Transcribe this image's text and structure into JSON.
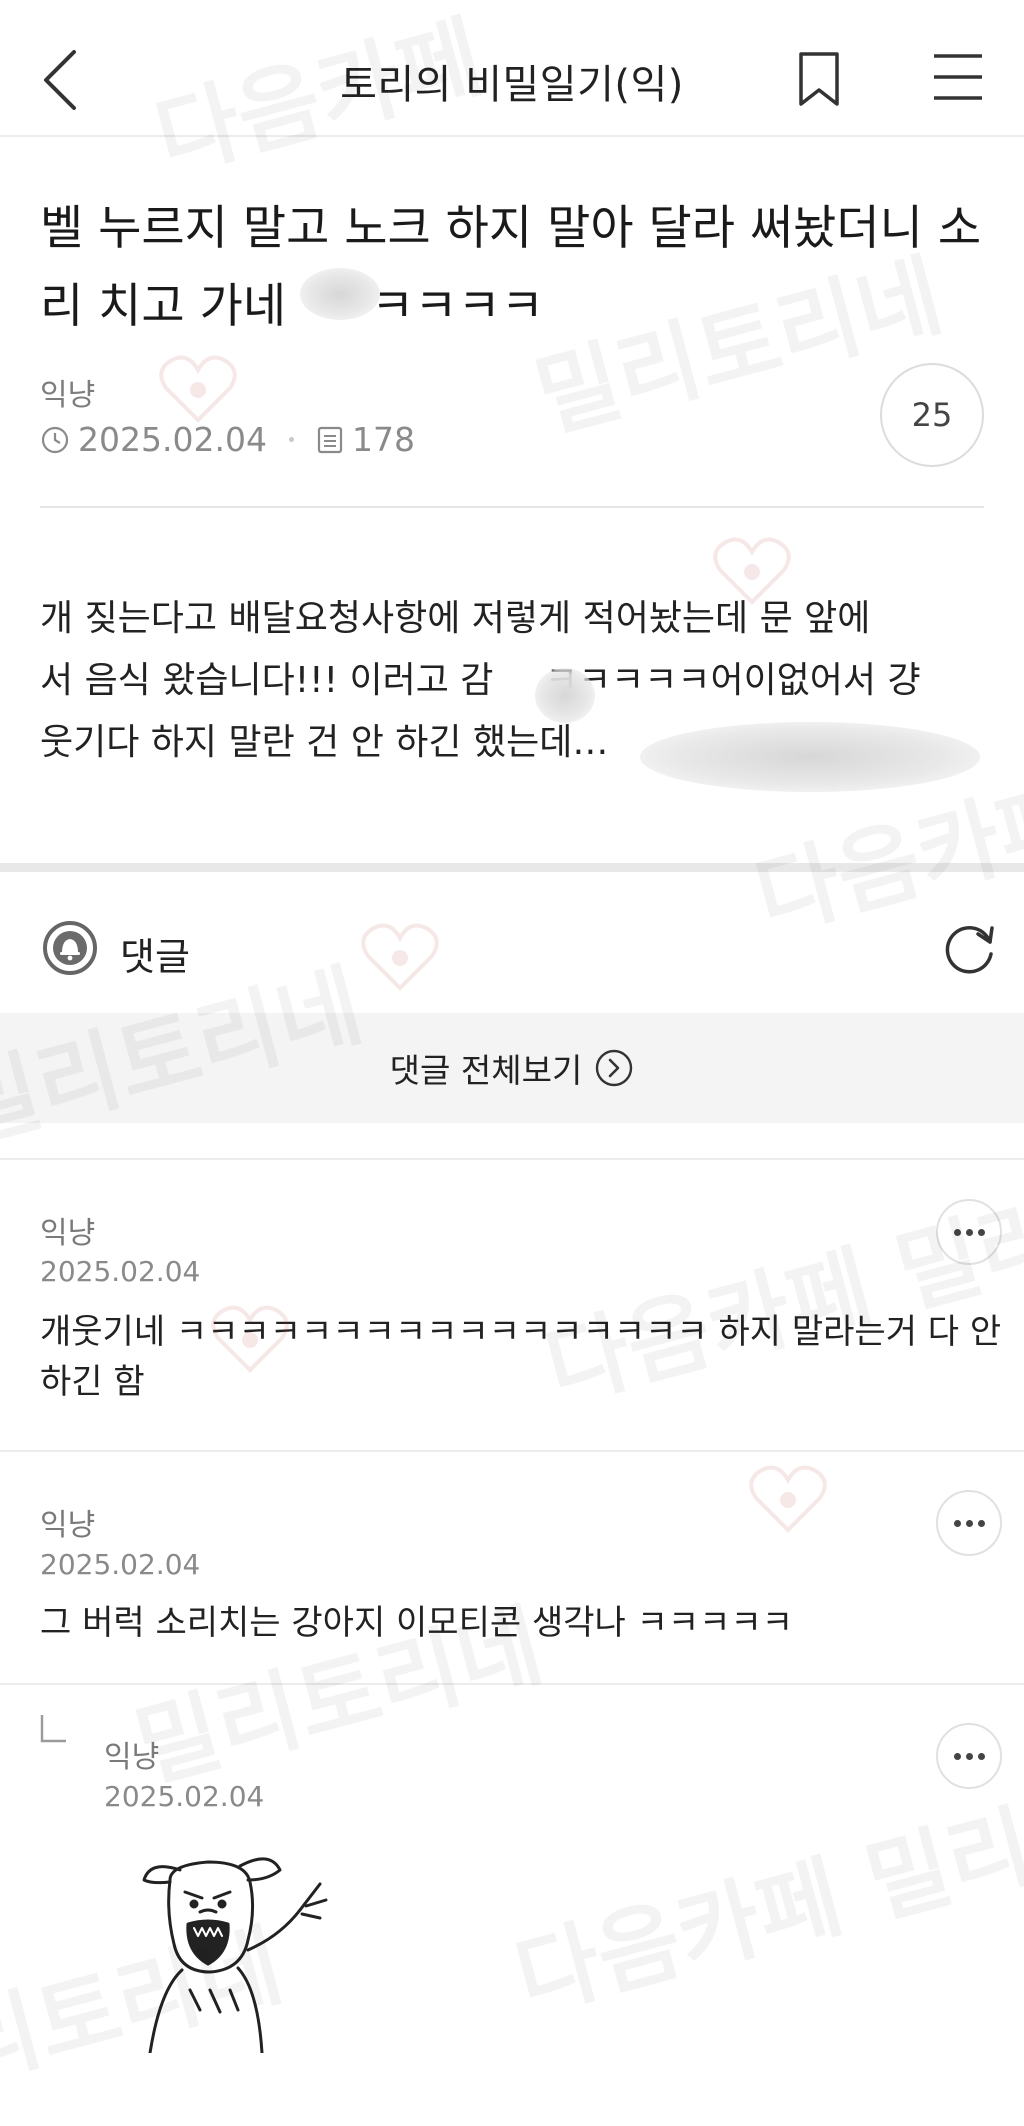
{
  "header": {
    "cafe_name": "토리의 비밀일기(익)"
  },
  "post": {
    "title_line1": "벨 누르지 말고 노크 하지 말아 달라 써놨더니 소",
    "title_line2_a": "리 치고 가네 ",
    "title_line2_b": "ㅋㅋㅋㅋ",
    "author": "익냥",
    "date": "2025.02.04",
    "views": "178",
    "comment_count": "25",
    "body_line1": "개 짖는다고 배달요청사항에 저렇게 적어놨는데 문 앞에",
    "body_line2_a": "서 음식 왔습니다!!! 이러고 감 ",
    "body_line2_b": "ㅋㅋㅋㅋㅋ어이없어서 걍",
    "body_line3": "웃기다 하지 말란 건 안 하긴 했는데…"
  },
  "comments_section": {
    "label": "댓글",
    "view_all": "댓글 전체보기"
  },
  "comments": [
    {
      "author": "익냥",
      "date": "2025.02.04",
      "text_line1": "개웃기네 ㅋㅋㅋㅋㅋㅋㅋㅋㅋㅋㅋㅋㅋㅋㅋㅋㅋ 하지 말라는거 다 안",
      "text_line2": "하긴 함"
    },
    {
      "author": "익냥",
      "date": "2025.02.04",
      "text_line1": "그 버럭 소리치는 강아지 이모티콘 생각나 ㅋㅋㅋㅋㅋ"
    },
    {
      "author": "익냥",
      "date": "2025.02.04",
      "reply": true,
      "sticker": "shouting-dog-sticker"
    }
  ],
  "watermarks": {
    "text_a": "다음카페",
    "text_b": "밀리토리네",
    "text_full": "다음카페 밀리토리네"
  },
  "icons": [
    "back-arrow-icon",
    "bookmark-icon",
    "menu-icon",
    "clock-icon",
    "document-icon",
    "bell-icon",
    "refresh-icon",
    "chevron-right-circle-icon",
    "more-icon",
    "reply-arrow-icon",
    "heart-paw-icon"
  ],
  "colors": {
    "text": "#1e1e1e",
    "meta": "#8a8a8a",
    "divider": "#e6e6e6",
    "band": "#f4f4f4"
  }
}
